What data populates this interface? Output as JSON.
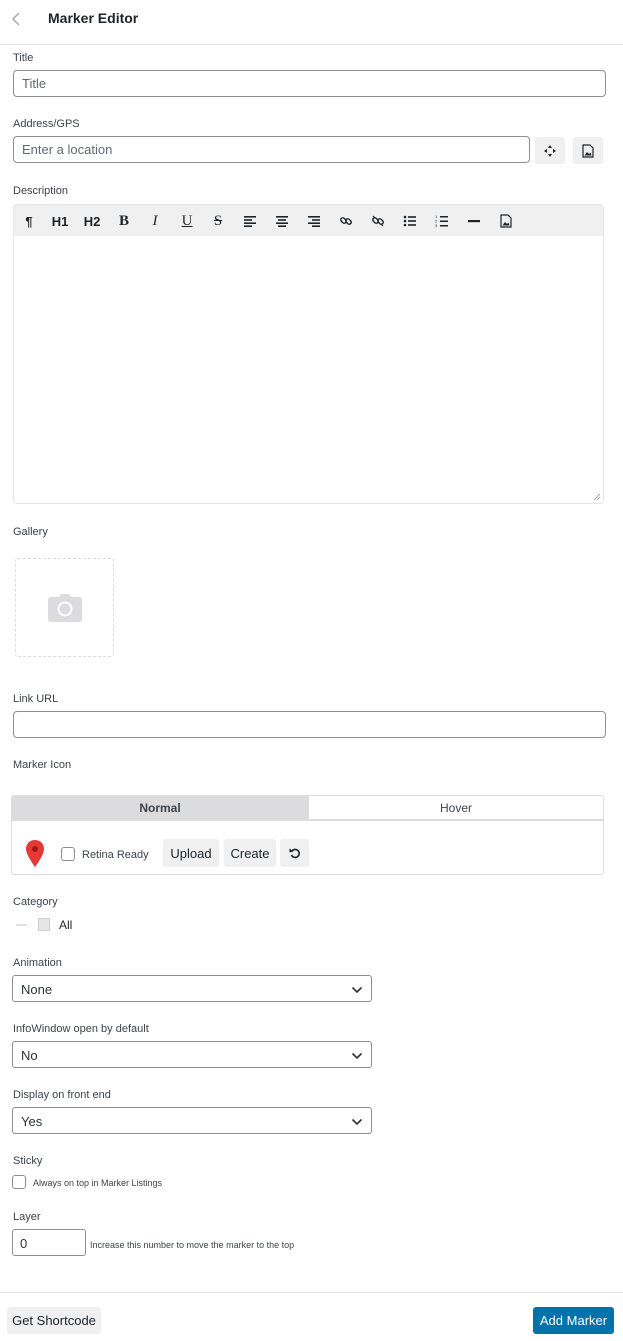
{
  "header": {
    "title": "Marker Editor"
  },
  "title_field": {
    "label": "Title",
    "placeholder": "Title",
    "value": ""
  },
  "address_field": {
    "label": "Address/GPS",
    "placeholder": "Enter a location",
    "value": ""
  },
  "description": {
    "label": "Description",
    "toolbar": {
      "paragraph": "¶",
      "h1": "H1",
      "h2": "H2",
      "bold": "B",
      "italic": "I",
      "underline": "U",
      "strike": "S"
    }
  },
  "gallery": {
    "label": "Gallery"
  },
  "link_url": {
    "label": "Link URL",
    "value": ""
  },
  "marker_icon": {
    "label": "Marker Icon",
    "tabs": [
      "Normal",
      "Hover"
    ],
    "retina_label": "Retina Ready",
    "upload_label": "Upload",
    "create_label": "Create",
    "pin_color": "#e53935"
  },
  "category": {
    "label": "Category",
    "all_label": "All"
  },
  "animation": {
    "label": "Animation",
    "value": "None"
  },
  "infowindow": {
    "label": "InfoWindow open by default",
    "value": "No"
  },
  "display_front": {
    "label": "Display on front end",
    "value": "Yes"
  },
  "sticky": {
    "label": "Sticky",
    "checkbox_label": "Always on top in Marker Listings"
  },
  "layer": {
    "label": "Layer",
    "value": "0",
    "hint": "Increase this number to move the marker to the top"
  },
  "footer": {
    "shortcode_label": "Get Shortcode",
    "add_label": "Add Marker",
    "accent": "#0073aa"
  }
}
